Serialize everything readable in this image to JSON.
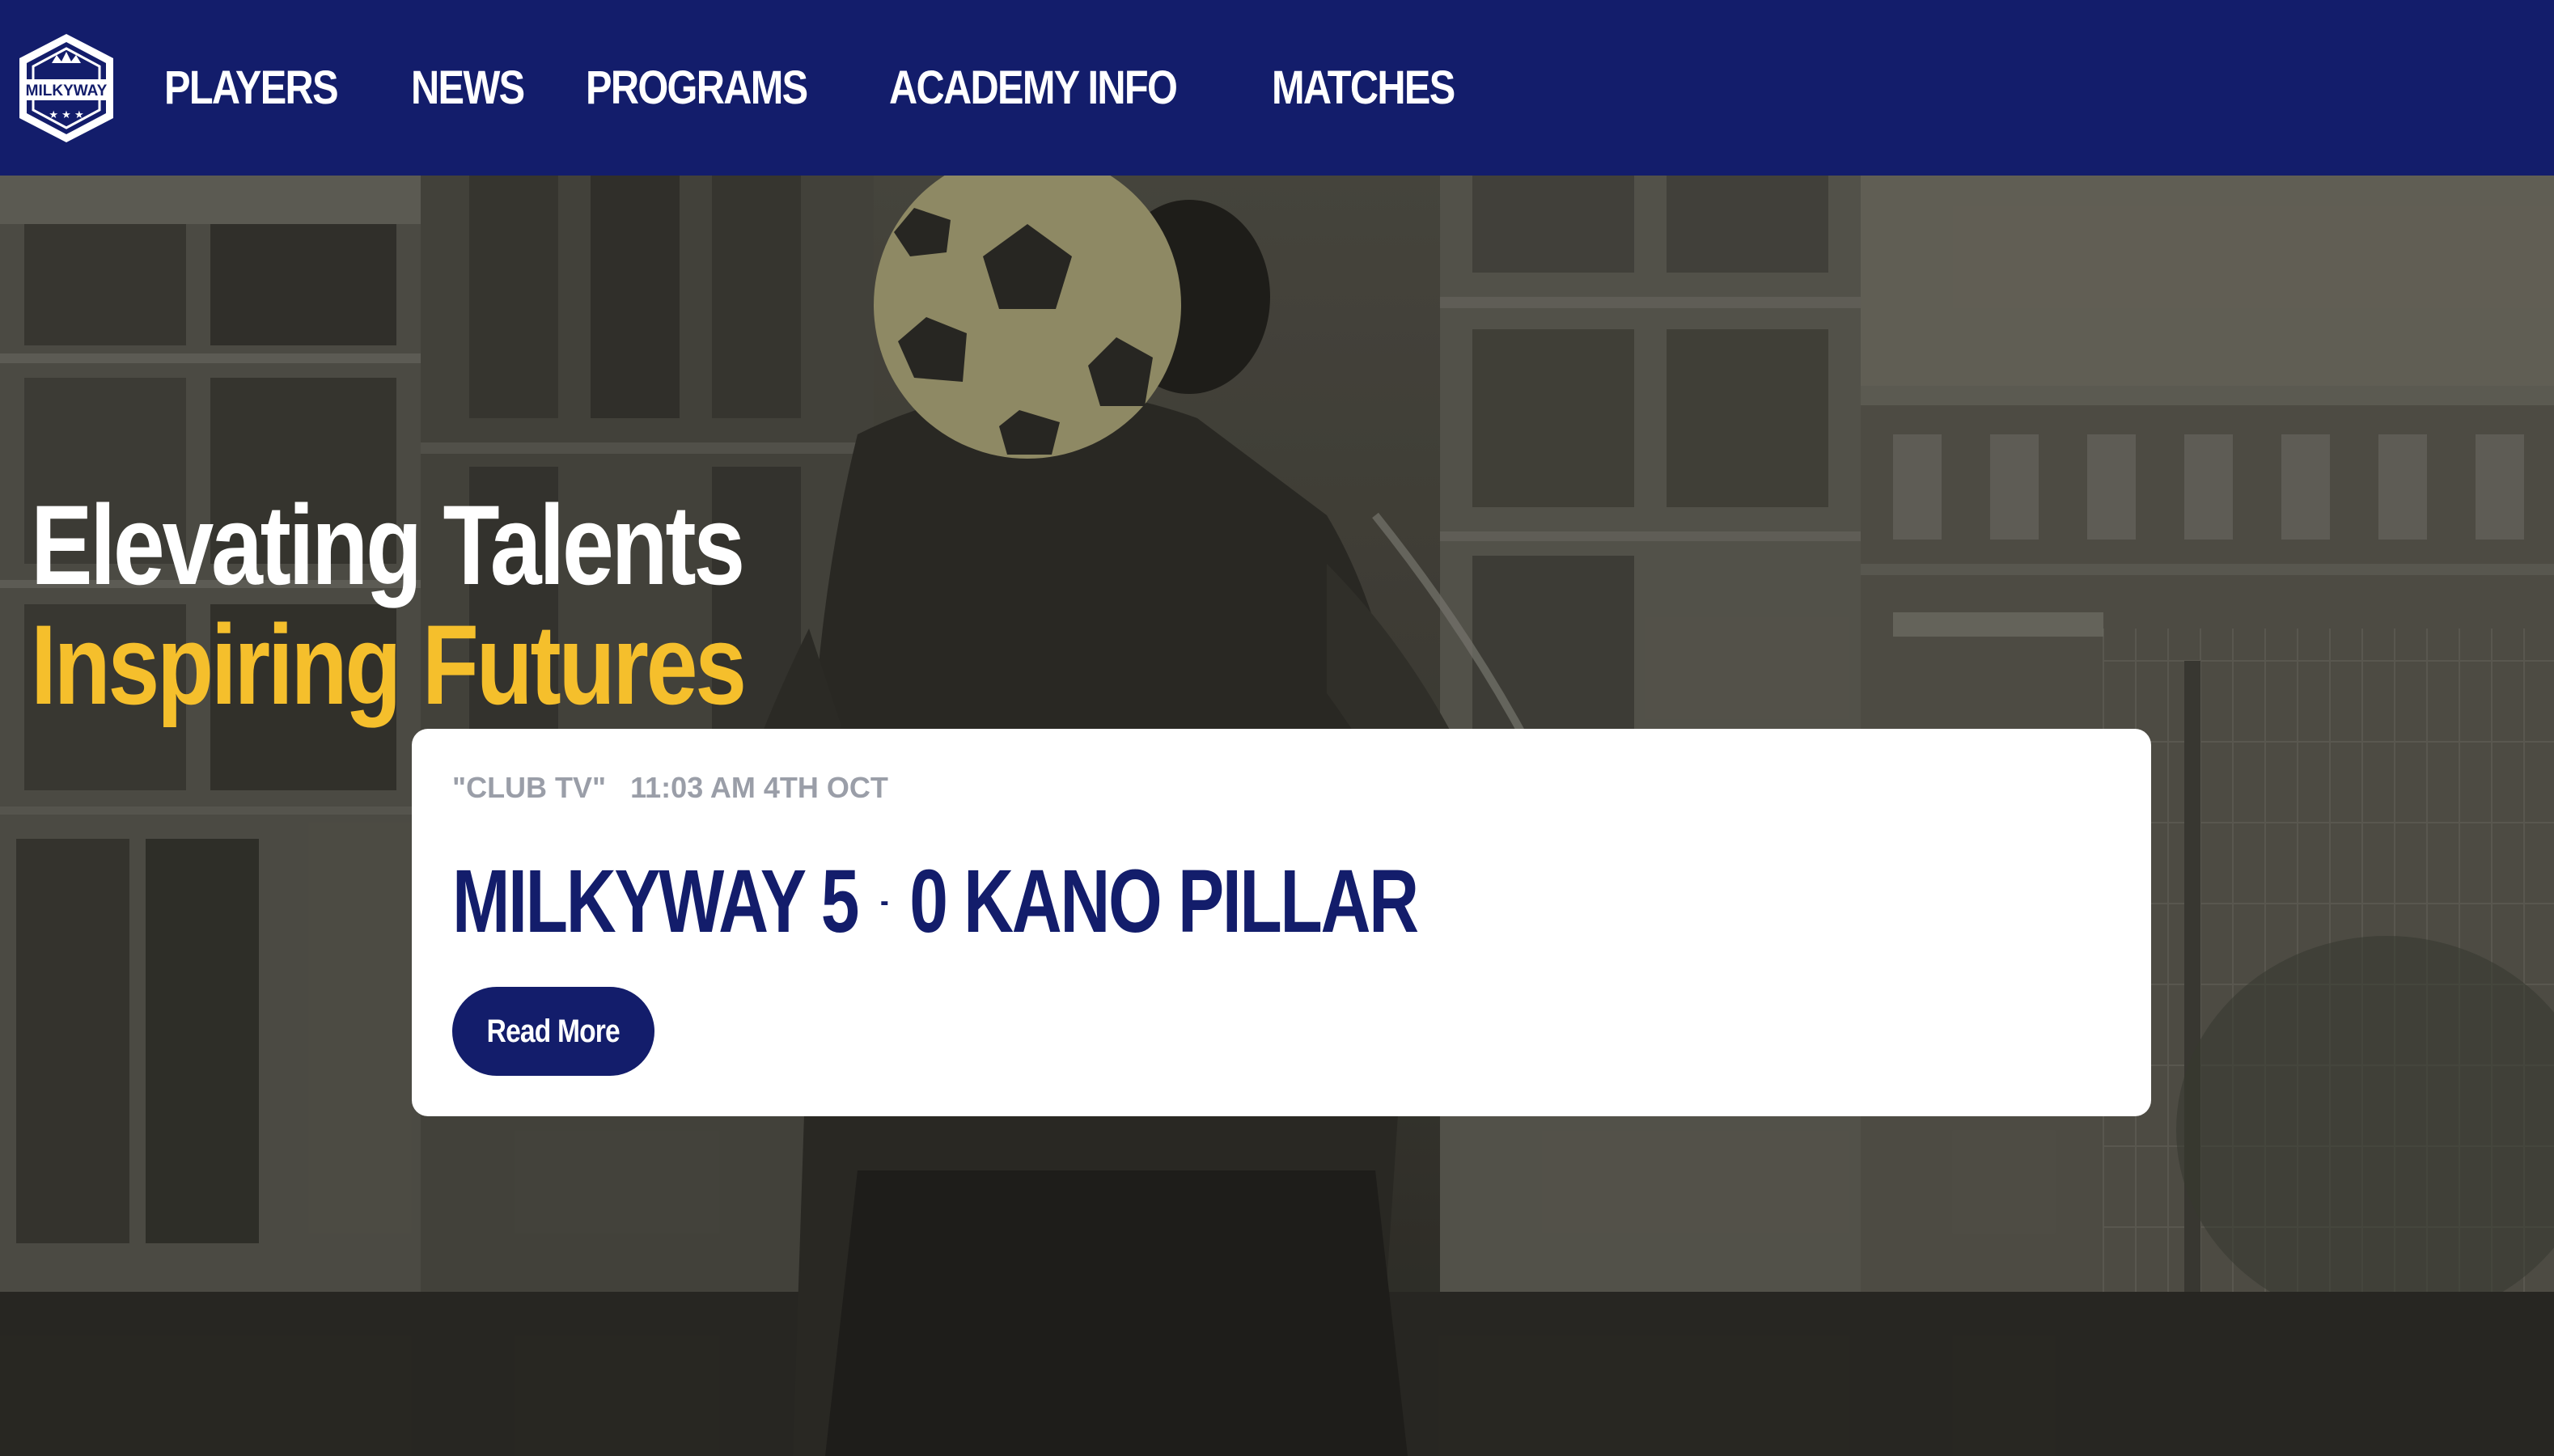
{
  "brand": {
    "logo_text": "MILKYWAY",
    "navbar_color": "#131d6b",
    "accent_color": "#f5bf2c"
  },
  "nav": {
    "items": [
      {
        "label": "PLAYERS"
      },
      {
        "label": "NEWS"
      },
      {
        "label": "PROGRAMS"
      },
      {
        "label": "ACADEMY INFO"
      },
      {
        "label": "MATCHES"
      }
    ]
  },
  "hero": {
    "line1": "Elevating Talents",
    "line2": "Inspiring Futures",
    "background": "photo of a player juggling a football in an urban court"
  },
  "news_card": {
    "category": "\"CLUB TV\"",
    "timestamp": "11:03 AM 4TH OCT",
    "title_left": "MILKYWAY 5",
    "title_separator": "-",
    "title_right": "0 KANO PILLAR",
    "button_label": "Read More"
  }
}
